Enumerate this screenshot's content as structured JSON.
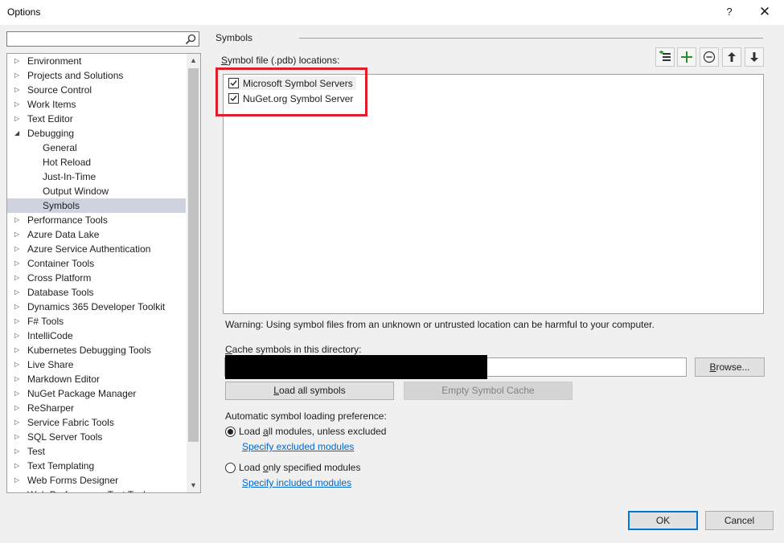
{
  "window": {
    "title": "Options",
    "help_label": "?",
    "close_label": "✕"
  },
  "search": {
    "value": "",
    "placeholder": ""
  },
  "tree": {
    "items": [
      {
        "label": "Environment",
        "arrow": "▷"
      },
      {
        "label": "Projects and Solutions",
        "arrow": "▷"
      },
      {
        "label": "Source Control",
        "arrow": "▷"
      },
      {
        "label": "Work Items",
        "arrow": "▷"
      },
      {
        "label": "Text Editor",
        "arrow": "▷"
      },
      {
        "label": "Debugging",
        "arrow": "◢"
      },
      {
        "label": "General"
      },
      {
        "label": "Hot Reload"
      },
      {
        "label": "Just-In-Time"
      },
      {
        "label": "Output Window"
      },
      {
        "label": "Symbols"
      },
      {
        "label": "Performance Tools",
        "arrow": "▷"
      },
      {
        "label": "Azure Data Lake",
        "arrow": "▷"
      },
      {
        "label": "Azure Service Authentication",
        "arrow": "▷"
      },
      {
        "label": "Container Tools",
        "arrow": "▷"
      },
      {
        "label": "Cross Platform",
        "arrow": "▷"
      },
      {
        "label": "Database Tools",
        "arrow": "▷"
      },
      {
        "label": "Dynamics 365 Developer Toolkit",
        "arrow": "▷"
      },
      {
        "label": "F# Tools",
        "arrow": "▷"
      },
      {
        "label": "IntelliCode",
        "arrow": "▷"
      },
      {
        "label": "Kubernetes Debugging Tools",
        "arrow": "▷"
      },
      {
        "label": "Live Share",
        "arrow": "▷"
      },
      {
        "label": "Markdown Editor",
        "arrow": "▷"
      },
      {
        "label": "NuGet Package Manager",
        "arrow": "▷"
      },
      {
        "label": "ReSharper",
        "arrow": "▷"
      },
      {
        "label": "Service Fabric Tools",
        "arrow": "▷"
      },
      {
        "label": "SQL Server Tools",
        "arrow": "▷"
      },
      {
        "label": "Test",
        "arrow": "▷"
      },
      {
        "label": "Text Templating",
        "arrow": "▷"
      },
      {
        "label": "Web Forms Designer",
        "arrow": "▷"
      },
      {
        "label": "Web Performance Test Tools",
        "arrow": "▷"
      }
    ],
    "scroll_up": "▲",
    "scroll_down": "▼"
  },
  "symbols": {
    "section_title": "Symbols",
    "locations_label_key": "S",
    "locations_label_rest": "ymbol file (.pdb) locations:",
    "locations": [
      {
        "label": "Microsoft Symbol Servers",
        "checked": true
      },
      {
        "label": "NuGet.org Symbol Server",
        "checked": true
      }
    ],
    "warning": "Warning: Using symbol files from an unknown or untrusted location can be harmful to your computer.",
    "cache_label_key": "C",
    "cache_label_rest": "ache symbols in this directory:",
    "cache_path": "",
    "browse_key": "B",
    "browse_rest": "rowse...",
    "load_all_key": "L",
    "load_all_rest": "oad all symbols",
    "empty_cache_label": "Empty Symbol Cache",
    "auto_pref_label": "Automatic symbol loading preference:",
    "radio_all_pre": "Load ",
    "radio_all_key": "a",
    "radio_all_post": "ll modules, unless excluded",
    "link_excluded": "Specify excluded modules",
    "radio_specified_pre": "Load ",
    "radio_specified_key": "o",
    "radio_specified_post": "nly specified modules",
    "link_included": "Specify included modules",
    "selected_preference": "all"
  },
  "footer": {
    "ok_label": "OK",
    "cancel_label": "Cancel"
  },
  "colors": {
    "highlight_box": "#e01e2b",
    "link": "#0066cc",
    "selection": "#cfd3e0",
    "add_icon": "#2e8b2e"
  }
}
